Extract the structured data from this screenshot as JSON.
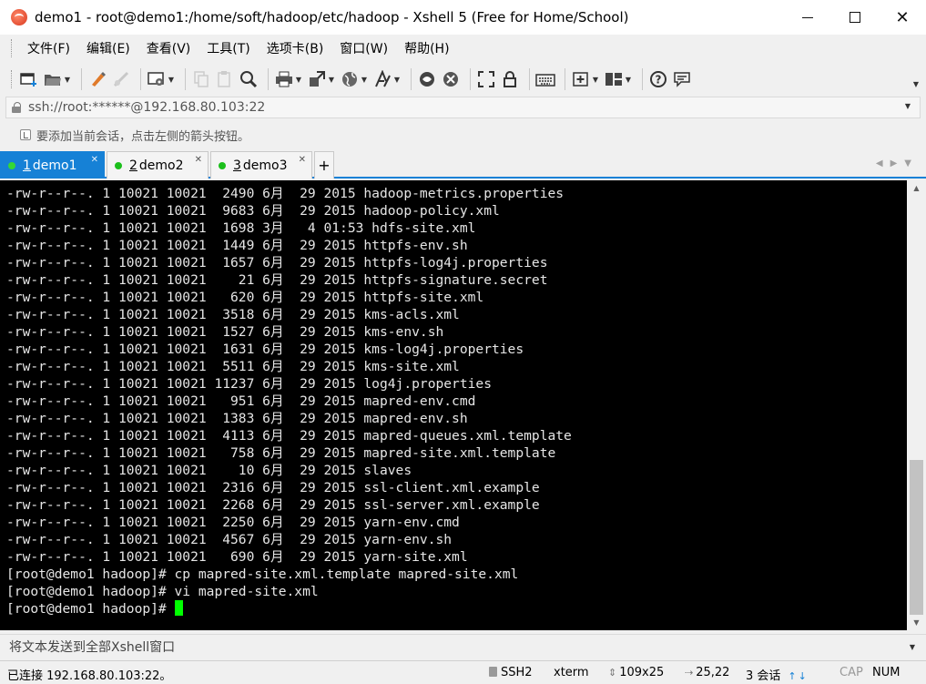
{
  "window": {
    "title": "demo1 - root@demo1:/home/soft/hadoop/etc/hadoop - Xshell 5 (Free for Home/School)",
    "minimize": "—",
    "maximize": "☐",
    "close": "✕"
  },
  "menu": [
    "文件(F)",
    "编辑(E)",
    "查看(V)",
    "工具(T)",
    "选项卡(B)",
    "窗口(W)",
    "帮助(H)"
  ],
  "toolbar": {
    "icons": [
      "new-session-icon",
      "open-folder-icon",
      "paint-icon",
      "disconnect-icon",
      "properties-icon",
      "copy-icon",
      "paste-icon",
      "find-icon",
      "print-icon",
      "transfer-icon",
      "globe-icon",
      "font-icon",
      "xftp-icon",
      "xmanager-icon",
      "fullscreen-icon",
      "lock-icon",
      "keyboard-icon",
      "add-tab-icon",
      "layout-icon",
      "help-icon",
      "chat-icon"
    ]
  },
  "address": {
    "value": "ssh://root:******@192.168.80.103:22"
  },
  "hint": {
    "text": "要添加当前会话，点击左侧的箭头按钮。"
  },
  "tabs": [
    {
      "num": "1",
      "label": " demo1",
      "active": true
    },
    {
      "num": "2",
      "label": " demo2",
      "active": false
    },
    {
      "num": "3",
      "label": " demo3",
      "active": false
    }
  ],
  "terminal": {
    "lines": [
      "-rw-r--r--. 1 10021 10021  2490 6月  29 2015 hadoop-metrics.properties",
      "-rw-r--r--. 1 10021 10021  9683 6月  29 2015 hadoop-policy.xml",
      "-rw-r--r--. 1 10021 10021  1698 3月   4 01:53 hdfs-site.xml",
      "-rw-r--r--. 1 10021 10021  1449 6月  29 2015 httpfs-env.sh",
      "-rw-r--r--. 1 10021 10021  1657 6月  29 2015 httpfs-log4j.properties",
      "-rw-r--r--. 1 10021 10021    21 6月  29 2015 httpfs-signature.secret",
      "-rw-r--r--. 1 10021 10021   620 6月  29 2015 httpfs-site.xml",
      "-rw-r--r--. 1 10021 10021  3518 6月  29 2015 kms-acls.xml",
      "-rw-r--r--. 1 10021 10021  1527 6月  29 2015 kms-env.sh",
      "-rw-r--r--. 1 10021 10021  1631 6月  29 2015 kms-log4j.properties",
      "-rw-r--r--. 1 10021 10021  5511 6月  29 2015 kms-site.xml",
      "-rw-r--r--. 1 10021 10021 11237 6月  29 2015 log4j.properties",
      "-rw-r--r--. 1 10021 10021   951 6月  29 2015 mapred-env.cmd",
      "-rw-r--r--. 1 10021 10021  1383 6月  29 2015 mapred-env.sh",
      "-rw-r--r--. 1 10021 10021  4113 6月  29 2015 mapred-queues.xml.template",
      "-rw-r--r--. 1 10021 10021   758 6月  29 2015 mapred-site.xml.template",
      "-rw-r--r--. 1 10021 10021    10 6月  29 2015 slaves",
      "-rw-r--r--. 1 10021 10021  2316 6月  29 2015 ssl-client.xml.example",
      "-rw-r--r--. 1 10021 10021  2268 6月  29 2015 ssl-server.xml.example",
      "-rw-r--r--. 1 10021 10021  2250 6月  29 2015 yarn-env.cmd",
      "-rw-r--r--. 1 10021 10021  4567 6月  29 2015 yarn-env.sh",
      "-rw-r--r--. 1 10021 10021   690 6月  29 2015 yarn-site.xml",
      "[root@demo1 hadoop]# cp mapred-site.xml.template mapred-site.xml",
      "[root@demo1 hadoop]# vi mapred-site.xml"
    ],
    "prompt": "[root@demo1 hadoop]# ",
    "cursor_color": "#00ff00"
  },
  "scrollbar": {
    "position_fraction": 0.63,
    "visible_fraction": 0.37
  },
  "send_bar": {
    "placeholder": "将文本发送到全部Xshell窗口"
  },
  "status": {
    "connection": "已连接 192.168.80.103:22。",
    "protocol": "SSH2",
    "terminal": "xterm",
    "size": "109x25",
    "cursor": "25,22",
    "sessions": "3 会话",
    "cap": "CAP",
    "num": "NUM"
  },
  "colors": {
    "accent": "#1681d6",
    "tab_dot": "#1bbf1b",
    "terminal_bg": "#000000",
    "terminal_fg": "#e6e6e6"
  }
}
